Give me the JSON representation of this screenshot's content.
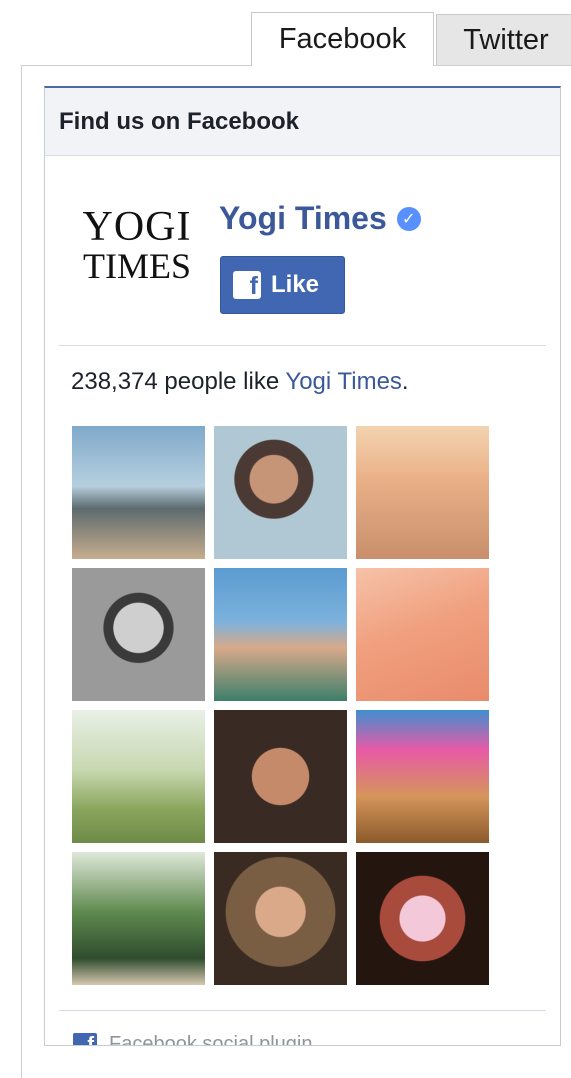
{
  "tabs": [
    {
      "label": "Facebook",
      "active": true
    },
    {
      "label": "Twitter",
      "active": false
    }
  ],
  "widget": {
    "header": "Find us on Facebook",
    "logo_line1": "YOGI",
    "logo_line2": "TIMES",
    "page_name": "Yogi Times",
    "verified_icon": "✓",
    "like_label": "Like",
    "like_count_text": "238,374 people like ",
    "like_page_link": "Yogi Times",
    "like_suffix": ".",
    "footer_label": "Facebook social plugin"
  },
  "colors": {
    "fb_blue": "#4267b2",
    "link_blue": "#3b5998",
    "verified": "#5890ff"
  },
  "faces": [
    {
      "name": "face-1",
      "bg": "linear-gradient(180deg,#7fa9c9 0%,#b6cfe0 45%,#5d6a6e 62%,#c7ad8e 100%)"
    },
    {
      "name": "face-2",
      "bg": "radial-gradient(circle at 45% 40%,#c69477 0 22%,#4b3a33 23% 36%,#b0c7d4 37% 100%)"
    },
    {
      "name": "face-3",
      "bg": "linear-gradient(180deg,#f3d3b0 0%,#eab088 40%,#d8a07a 70%,#c98f6c 100%)"
    },
    {
      "name": "face-4",
      "bg": "radial-gradient(circle at 50% 45%,#cfcfcf 0 25%,#3a3a3a 26% 35%,#9a9a9a 36% 100%)"
    },
    {
      "name": "face-5",
      "bg": "linear-gradient(180deg,#5b9bd1 0%,#7bb2dc 40%,#d8a98a 60%,#3c7f6a 100%)"
    },
    {
      "name": "face-6",
      "bg": "linear-gradient(160deg,#f6c2a8 0%,#f0a07f 45%,#e98b6b 100%)"
    },
    {
      "name": "face-7",
      "bg": "linear-gradient(180deg,#e9f0e6 0%,#c7d8b0 45%,#8aa55c 75%,#6e8a47 100%)"
    },
    {
      "name": "face-8",
      "bg": "radial-gradient(circle at 50% 50%,#c48a6a 0 30%,#3a2a24 31% 100%)"
    },
    {
      "name": "face-9",
      "bg": "linear-gradient(180deg,#3f8fd0 0%,#e85aa6 30%,#d5955a 65%,#8b5a2b 100%)"
    },
    {
      "name": "face-10",
      "bg": "linear-gradient(180deg,#dfe8d9 0%,#5f8a4f 45%,#2f4c2e 80%,#d7c8b0 100%)"
    },
    {
      "name": "face-11",
      "bg": "radial-gradient(circle at 50% 45%,#d9a98a 0 25%,#7a5e43 26% 55%,#3a2b22 56% 100%)"
    },
    {
      "name": "face-12",
      "bg": "radial-gradient(circle at 50% 50%,#f3c8d8 0 24%,#a84b3c 25% 45%,#24150f 46% 100%)"
    }
  ]
}
